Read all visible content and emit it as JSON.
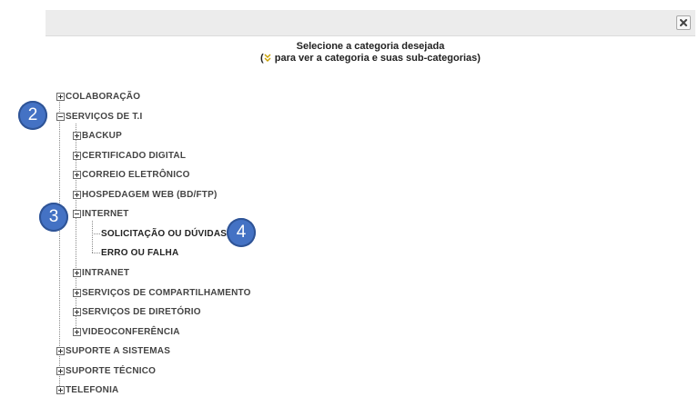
{
  "dialog": {
    "close_symbol": "✖",
    "heading_line1": "Selecione a categoria desejada",
    "heading_line2_pre": "(",
    "heading_line2_post": " para ver a categoria e suas sub-categorias)"
  },
  "tree": {
    "colaboracao": "COLABORAÇÃO",
    "servicos_ti": "SERVIÇOS DE T.I",
    "backup": "BACKUP",
    "certificado": "CERTIFICADO DIGITAL",
    "correio": "CORREIO ELETRÔNICO",
    "hospedagem": "HOSPEDAGEM WEB (BD/FTP)",
    "internet": "INTERNET",
    "solicitacao": "SOLICITAÇÃO OU DÚVIDAS",
    "erro": "ERRO OU FALHA",
    "intranet": "INTRANET",
    "compartilhamento": "SERVIÇOS DE COMPARTILHAMENTO",
    "diretorio": "SERVIÇOS DE DIRETÓRIO",
    "videoconferencia": "VIDEOCONFERÊNCIA",
    "suporte_sistemas": "SUPORTE A SISTEMAS",
    "suporte_tecnico": "SUPORTE TÉCNICO",
    "telefonia": "TELEFONIA"
  },
  "badges": [
    "2",
    "3",
    "4"
  ]
}
